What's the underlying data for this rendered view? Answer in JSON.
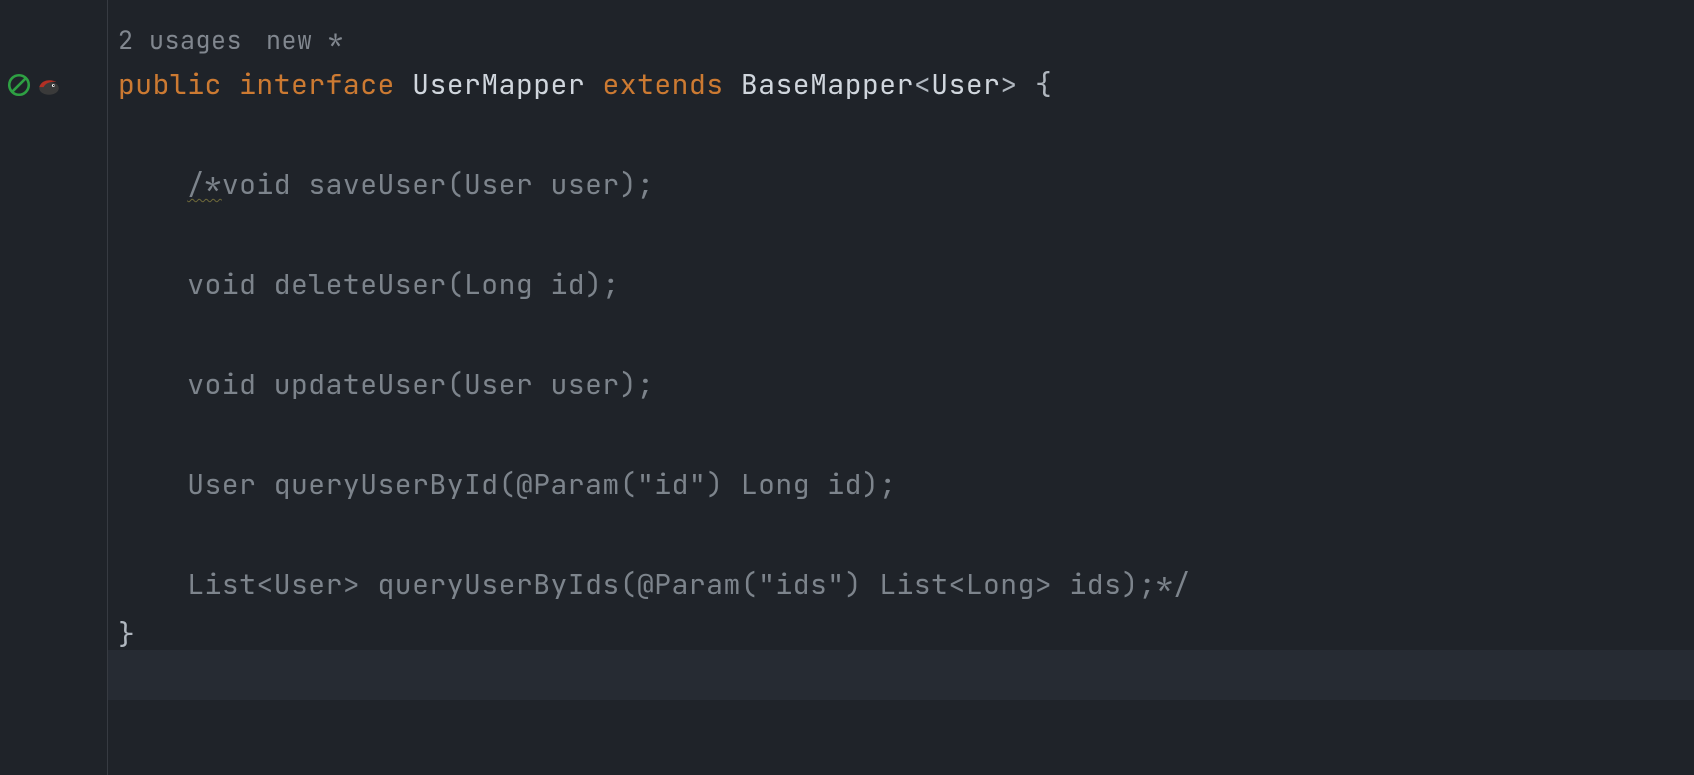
{
  "hints": {
    "usages": "2 usages",
    "author": "new *"
  },
  "code": {
    "line1": {
      "public": "public",
      "interface": "interface",
      "name": "UserMapper",
      "extends": "extends",
      "base": "BaseMapper",
      "generic_open": "<",
      "generic_type": "User",
      "generic_close": ">",
      "brace": " {"
    },
    "comment": {
      "l1a": "/*",
      "l1b": "void saveUser(User user);",
      "l2": "void deleteUser(Long id);",
      "l3": "void updateUser(User user);",
      "l4": "User queryUserById(@Param(\"id\") Long id);",
      "l5": "List<User> queryUserByIds(@Param(\"ids\") List<Long> ids);*/"
    },
    "close_brace": "}"
  },
  "icons": {
    "no_entry": "no-entry-icon",
    "mybatis_bird": "mybatis-bird-icon"
  }
}
